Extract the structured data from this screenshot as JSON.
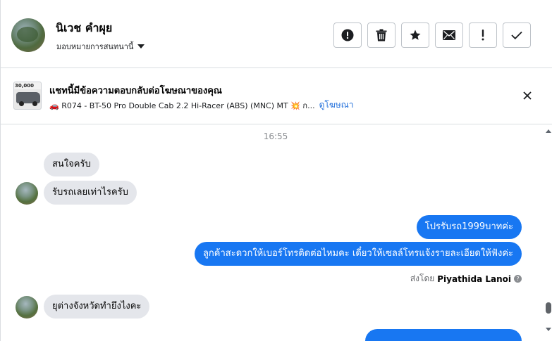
{
  "contact": {
    "name": "นิเวช คำผุย",
    "assign_label": "มอบหมายการสนทนานี้"
  },
  "toolbar": {
    "buttons": [
      {
        "icon": "alert-circle-icon",
        "name": "mark-spam-button"
      },
      {
        "icon": "trash-icon",
        "name": "delete-button"
      },
      {
        "icon": "star-icon",
        "name": "star-button"
      },
      {
        "icon": "envelope-icon",
        "name": "mark-unread-button"
      },
      {
        "icon": "exclamation-icon",
        "name": "follow-up-button"
      },
      {
        "icon": "check-icon",
        "name": "mark-done-button"
      }
    ]
  },
  "ad_banner": {
    "title": "แชทนี้มีข้อความตอบกลับต่อโฆษณาของคุณ",
    "ad_text": "🚗 R074 - BT-50 Pro Double Cab 2.2 Hi-Racer (ABS) (MNC) MT 💥 ก...",
    "view_ad_link": "ดูโฆษณา",
    "thumb_price": "30,000"
  },
  "conversation": {
    "timestamp": "16:55",
    "messages": [
      {
        "direction": "in",
        "text": "สนใจครับ"
      },
      {
        "direction": "in",
        "text": "รับรถเลยเท่าไรครับ"
      },
      {
        "direction": "out",
        "text": "โปรรับรถ1999บาทค่ะ"
      },
      {
        "direction": "out",
        "text": "ลูกค้าสะดวกให้เบอร์โทรติดต่อไหมคะ เดี๋ยวให้เซลล์โทรแจ้งรายละเอียดให้ฟังค่ะ"
      },
      {
        "direction": "in",
        "text": "ยุต่างจังหวัดทำยึงไงคะ"
      }
    ],
    "sent_by_prefix": "ส่งโดย",
    "sent_by_name": "Piyathida Lanoi"
  },
  "colors": {
    "outgoing_bubble": "#1877f2",
    "incoming_bubble": "#e4e6eb",
    "link": "#216fdb"
  }
}
